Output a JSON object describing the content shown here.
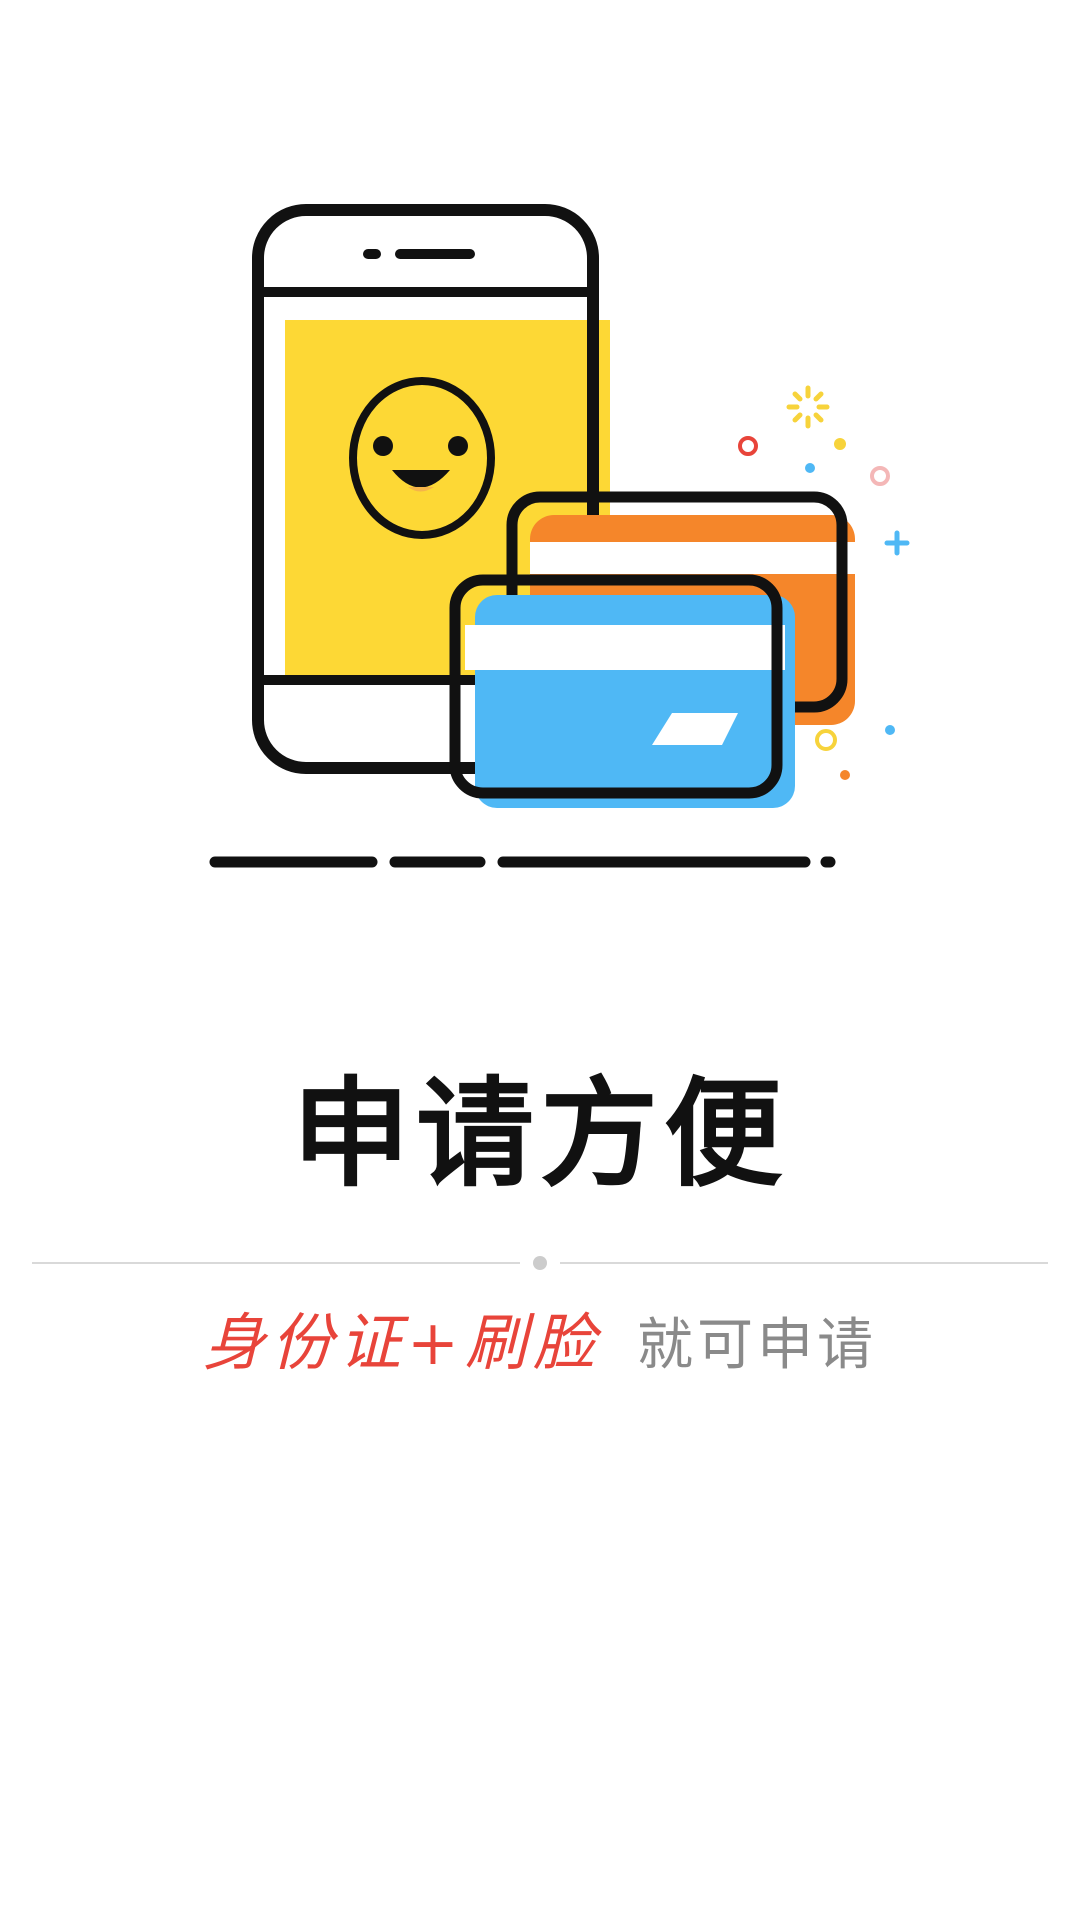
{
  "illustration": {
    "colors": {
      "outline": "#111111",
      "screen_yellow": "#FDD835",
      "card_orange": "#F5862A",
      "card_blue": "#4FB8F5",
      "sparkle_yellow": "#F7D33B",
      "sparkle_red": "#E8443A",
      "sparkle_blue": "#4FB8F5",
      "sparkle_pink": "#F4B7B7",
      "sparkle_orange": "#F5862A"
    },
    "icons": [
      "phone-icon",
      "smiley-face-icon",
      "bank-card-icon",
      "sparkle-icon"
    ]
  },
  "headline": "申请方便",
  "subline": {
    "highlight": "身份证+刷脸",
    "rest": "就可申请"
  },
  "colors": {
    "highlight": "#E8443A",
    "rest": "#8A8A8A",
    "divider": "#D9D9D9"
  }
}
